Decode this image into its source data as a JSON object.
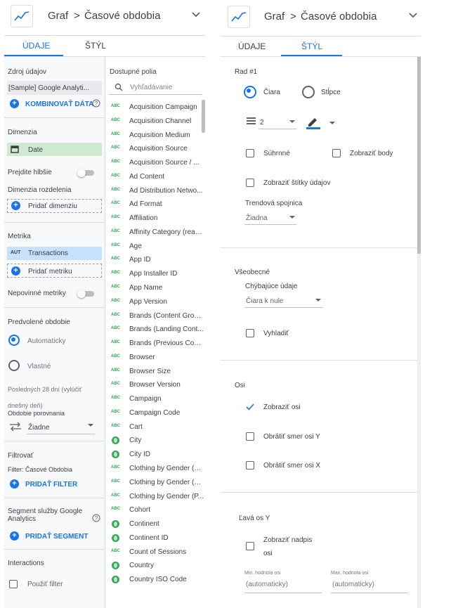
{
  "left_panel": {
    "header": {
      "breadcrumb_root": "Graf",
      "breadcrumb_sep": ">",
      "breadcrumb_page": "Časové obdobia"
    },
    "tabs": [
      {
        "label": "ÚDAJE"
      },
      {
        "label": "ŠTÝL"
      }
    ],
    "data_source": {
      "title": "Zdroj údajov",
      "value": "[Sample] Google Analyti...",
      "blend_label": "KOMBINOVAŤ DÁTA"
    },
    "dimension": {
      "title": "Dimenzia",
      "value": "Date"
    },
    "drill_down": {
      "label": "Prejdite hlbšie"
    },
    "breakdown": {
      "title": "Dimenzia rozdelenia",
      "add_label": "Pridať dimenziu"
    },
    "metric": {
      "title": "Metrika",
      "badge": "AUT",
      "value": "Transactions",
      "add_label": "Pridať metriku"
    },
    "optional_metrics": {
      "label": "Nepovinné metriky"
    },
    "date_range": {
      "title": "Predvolené obdobie",
      "auto_label": "Automaticky",
      "custom_label": "Vlastné",
      "note_line1": "Posledných 28 dní (vylúčiť",
      "note_line2": "dnešný deň)",
      "compare_title": "Obdobie porovnania",
      "compare_value": "Žiadne"
    },
    "filter": {
      "title": "Filtrovať",
      "sub": "Filter: Časové Obdobia",
      "add_label": "PRIDAŤ FILTER"
    },
    "segment": {
      "title_line1": "Segment služby Google",
      "title_line2": "Analytics",
      "add_label": "PRIDAŤ SEGMENT"
    },
    "interactions": {
      "title": "Interactions",
      "option": "Použiť filter"
    },
    "fields": {
      "title": "Dostupné polia",
      "search_placeholder": "Vyhľadávanie",
      "items": [
        {
          "type": "ABC",
          "name": "Acquisition Campaign"
        },
        {
          "type": "ABC",
          "name": "Acquisition Channel"
        },
        {
          "type": "ABC",
          "name": "Acquisition Medium"
        },
        {
          "type": "ABC",
          "name": "Acquisition Source"
        },
        {
          "type": "ABC",
          "name": "Acquisition Source / ..."
        },
        {
          "type": "ABC",
          "name": "Ad Content"
        },
        {
          "type": "ABC",
          "name": "Ad Distribution Netwo..."
        },
        {
          "type": "ABC",
          "name": "Ad Format"
        },
        {
          "type": "ABC",
          "name": "Affiliation"
        },
        {
          "type": "ABC",
          "name": "Affinity Category (reac..."
        },
        {
          "type": "ABC",
          "name": "Age"
        },
        {
          "type": "ABC",
          "name": "App ID"
        },
        {
          "type": "ABC",
          "name": "App Installer ID"
        },
        {
          "type": "ABC",
          "name": "App Name"
        },
        {
          "type": "ABC",
          "name": "App Version"
        },
        {
          "type": "ABC",
          "name": "Brands (Content Group)"
        },
        {
          "type": "ABC",
          "name": "Brands (Landing Cont..."
        },
        {
          "type": "ABC",
          "name": "Brands (Previous Con..."
        },
        {
          "type": "ABC",
          "name": "Browser"
        },
        {
          "type": "ABC",
          "name": "Browser Size"
        },
        {
          "type": "ABC",
          "name": "Browser Version"
        },
        {
          "type": "ABC",
          "name": "Campaign"
        },
        {
          "type": "ABC",
          "name": "Campaign Code"
        },
        {
          "type": "ABC",
          "name": "Cart"
        },
        {
          "type": "geo",
          "name": "City"
        },
        {
          "type": "geo",
          "name": "City ID"
        },
        {
          "type": "ABC",
          "name": "Clothing by Gender (C..."
        },
        {
          "type": "ABC",
          "name": "Clothing by Gender (L..."
        },
        {
          "type": "ABC",
          "name": "Clothing by Gender (P..."
        },
        {
          "type": "ABC",
          "name": "Cohort"
        },
        {
          "type": "geo",
          "name": "Continent"
        },
        {
          "type": "geo",
          "name": "Continent ID"
        },
        {
          "type": "ABC",
          "name": "Count of Sessions"
        },
        {
          "type": "geo",
          "name": "Country"
        },
        {
          "type": "geo",
          "name": "Country ISO Code"
        }
      ]
    }
  },
  "right_panel": {
    "header": {
      "breadcrumb_root": "Graf",
      "breadcrumb_sep": ">",
      "breadcrumb_page": "Časové obdobia"
    },
    "tabs": [
      {
        "label": "ÚDAJE"
      },
      {
        "label": "ŠTÝL"
      }
    ],
    "series": {
      "title": "Rad #1",
      "line_label": "Čiara",
      "bars_label": "Stĺpce",
      "line_weight": "2",
      "cumulative_label": "Súhrnné",
      "show_points_label": "Zobraziť body",
      "data_labels_label": "Zobraziť štítky údajov",
      "trendline_title": "Trendová spojnica",
      "trendline_value": "Žiadna"
    },
    "general": {
      "title": "Všeobecné",
      "missing_title": "Chýbajúce údaje",
      "missing_value": "Čiara k nule",
      "smooth_label": "Vyhladiť"
    },
    "axes": {
      "title": "Osi",
      "show_axes_label": "Zobraziť osi",
      "reverse_y_label": "Obrátiť smer osi Y",
      "reverse_x_label": "Obrátiť smer osi X"
    },
    "left_y": {
      "title": "Ľavá os Y",
      "show_title_line1": "Zobraziť nadpis",
      "show_title_line2": "osi",
      "min_label": "Min. hodnota osi",
      "max_label": "Max. hodnota osi",
      "min_value": "(automaticky)",
      "max_value": "(automaticky)"
    }
  },
  "colors": {
    "accent": "#1a73e8",
    "dimension_bg": "#ccebd1",
    "metric_bg": "#c6e1fb",
    "panel_bg": "#f8f9fa",
    "field_icon": "#34a853"
  }
}
